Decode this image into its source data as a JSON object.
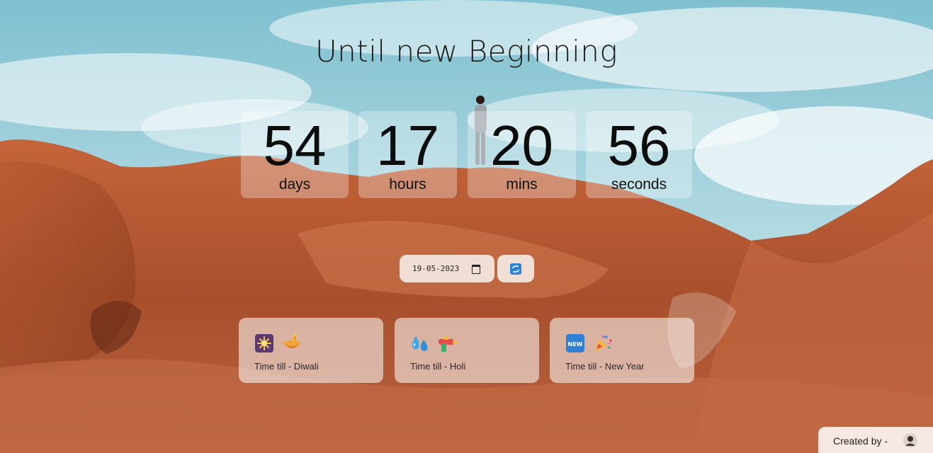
{
  "page": {
    "title": "Until new Beginning"
  },
  "countdown": [
    {
      "value": "54",
      "unit": "days"
    },
    {
      "value": "17",
      "unit": "hours"
    },
    {
      "value": "20",
      "unit": "mins"
    },
    {
      "value": "56",
      "unit": "seconds"
    }
  ],
  "controls": {
    "date_value": "19-05-2023",
    "calendar_icon": "calendar-icon",
    "refresh_icon": "refresh-icon"
  },
  "events": [
    {
      "label": "Time till - Diwali",
      "icons": [
        "sparkler-icon",
        "diya-lamp-icon"
      ]
    },
    {
      "label": "Time till - Holi",
      "icons": [
        "water-drops-icon",
        "water-gun-icon"
      ]
    },
    {
      "label": "Time till - New Year",
      "icons": [
        "new-badge-icon",
        "party-popper-icon"
      ]
    }
  ],
  "footer": {
    "credit_label": "Created by -",
    "avatar_icon": "avatar-icon"
  },
  "colors": {
    "sky": "#8ec9d6",
    "rock": "#b4532c",
    "accent_blue": "#2b83d6"
  }
}
